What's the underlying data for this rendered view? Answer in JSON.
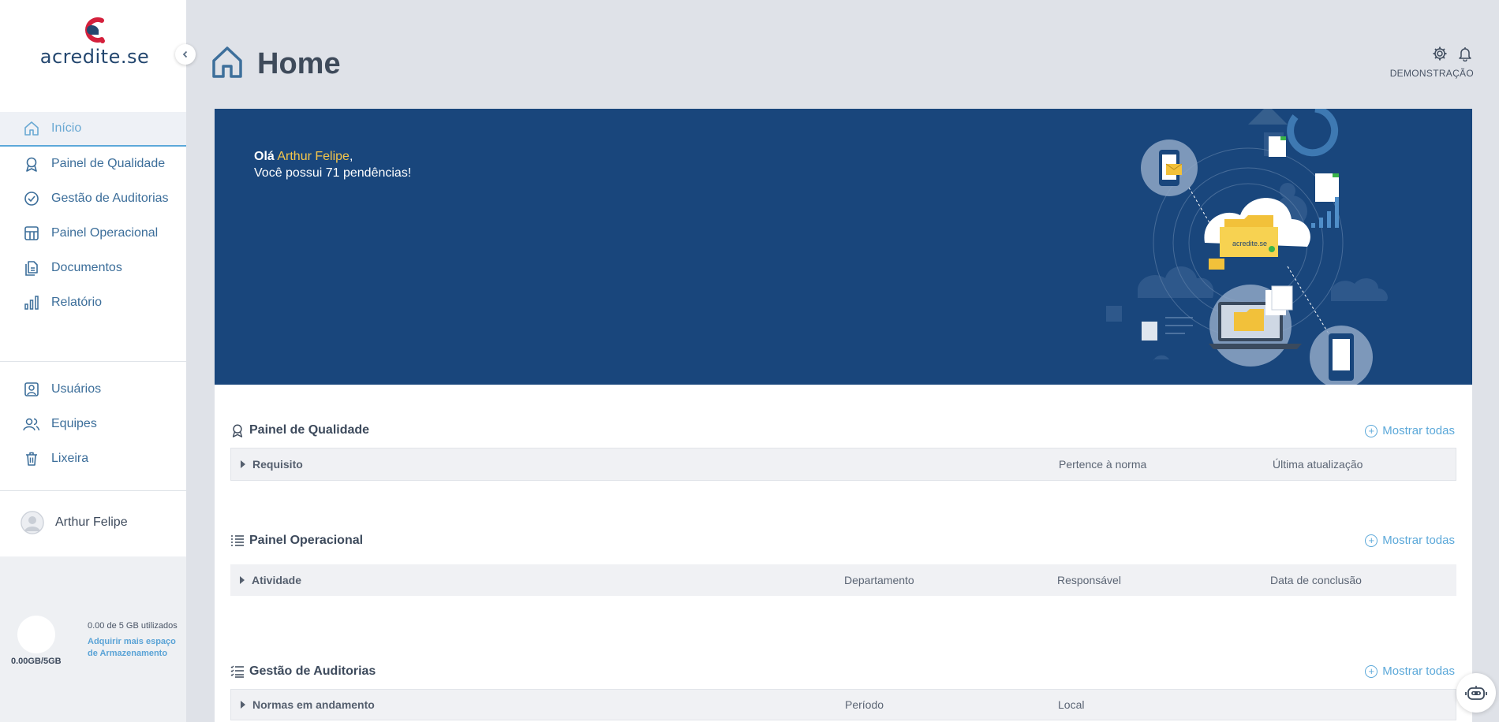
{
  "brand": {
    "name": "acredite.se",
    "primary": "#19467c",
    "accent": "#5ba8d9",
    "highlight": "#f4c54a",
    "logo_red": "#d4203c"
  },
  "sidebar": {
    "collapse_icon": "chevron-left-icon",
    "main_items": [
      {
        "label": "Início",
        "icon": "home-icon",
        "active": true
      },
      {
        "label": "Painel de Qualidade",
        "icon": "award-icon"
      },
      {
        "label": "Gestão de Auditorias",
        "icon": "check-circle-icon"
      },
      {
        "label": "Painel Operacional",
        "icon": "panel-icon"
      },
      {
        "label": "Documentos",
        "icon": "documents-icon"
      },
      {
        "label": "Relatório",
        "icon": "bar-chart-icon"
      }
    ],
    "admin_items": [
      {
        "label": "Usuários",
        "icon": "user-icon"
      },
      {
        "label": "Equipes",
        "icon": "team-icon"
      },
      {
        "label": "Lixeira",
        "icon": "trash-icon"
      }
    ],
    "user": {
      "name": "Arthur Felipe"
    },
    "storage": {
      "total_label": "0.00GB/5GB",
      "used_label": "0.00 de 5 GB utilizados",
      "upgrade_link": "Adquirir mais espaço de Armazenamento"
    }
  },
  "header": {
    "title": "Home",
    "org_name": "DEMONSTRAÇÃO",
    "icons": [
      "gear-icon",
      "bell-icon"
    ]
  },
  "banner": {
    "greeting_prefix": "Olá",
    "user_name": "Arthur Felipe",
    "greeting_suffix": ",",
    "pending_text": "Você possui 71 pendências!",
    "illustration_text": "acredite.se"
  },
  "sections": {
    "quality": {
      "title": "Painel de Qualidade",
      "show_all": "Mostrar todas",
      "columns": [
        "Requisito",
        "Pertence à norma",
        "Última atualização"
      ]
    },
    "operational": {
      "title": "Painel Operacional",
      "show_all": "Mostrar todas",
      "columns": [
        "Atividade",
        "Departamento",
        "Responsável",
        "Data de conclusão"
      ]
    },
    "audits": {
      "title": "Gestão de Auditorias",
      "show_all": "Mostrar todas",
      "columns": [
        "Normas em andamento",
        "Período",
        "Local"
      ]
    }
  },
  "assistant": {
    "icon": "robot-icon"
  }
}
